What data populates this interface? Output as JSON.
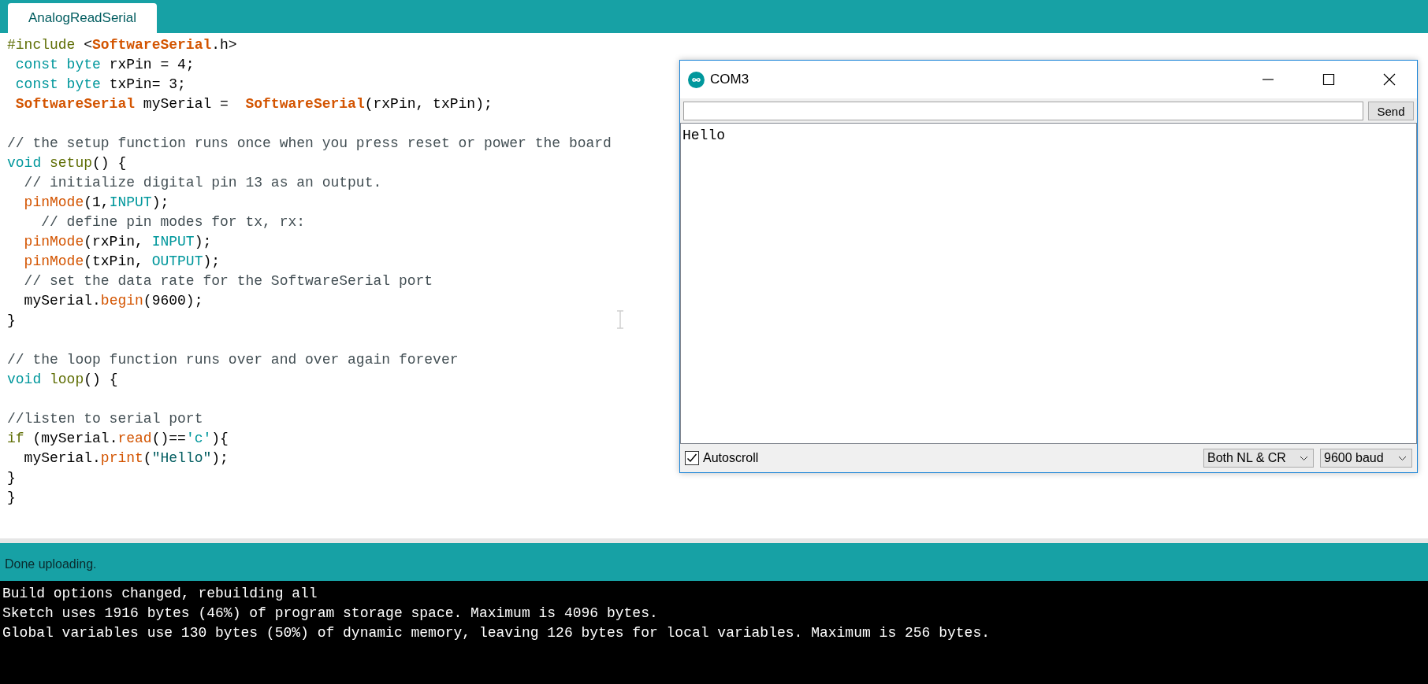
{
  "tabs": [
    {
      "label": "AnalogReadSerial",
      "selected": true
    }
  ],
  "editor": {
    "lines": [
      {
        "kind": "code",
        "tokens": [
          {
            "kind": "structure",
            "text": "#include"
          },
          {
            "kind": "plain",
            "text": " <"
          },
          {
            "kind": "class",
            "text": "SoftwareSerial"
          },
          {
            "kind": "plain",
            "text": ".h>"
          }
        ]
      },
      {
        "kind": "code",
        "tokens": [
          {
            "kind": "keyword",
            "text": " const"
          },
          {
            "kind": "keyword",
            "text": " byte"
          },
          {
            "kind": "plain",
            "text": " rxPin = 4;"
          }
        ]
      },
      {
        "kind": "code",
        "tokens": [
          {
            "kind": "keyword",
            "text": " const"
          },
          {
            "kind": "keyword",
            "text": " byte"
          },
          {
            "kind": "plain",
            "text": " txPin= 3;"
          }
        ]
      },
      {
        "kind": "code",
        "tokens": [
          {
            "kind": "class",
            "text": " SoftwareSerial"
          },
          {
            "kind": "plain",
            "text": " mySerial =  "
          },
          {
            "kind": "class",
            "text": "SoftwareSerial"
          },
          {
            "kind": "plain",
            "text": "(rxPin, txPin);"
          }
        ]
      },
      {
        "kind": "blank"
      },
      {
        "kind": "code",
        "tokens": [
          {
            "kind": "comment",
            "text": "// the setup function runs once when you press reset or power the board"
          }
        ]
      },
      {
        "kind": "code",
        "tokens": [
          {
            "kind": "keyword",
            "text": "void"
          },
          {
            "kind": "structure",
            "text": " setup"
          },
          {
            "kind": "plain",
            "text": "() {"
          }
        ]
      },
      {
        "kind": "code",
        "tokens": [
          {
            "kind": "comment",
            "text": "  // initialize digital pin 13 as an output."
          }
        ]
      },
      {
        "kind": "code",
        "tokens": [
          {
            "kind": "function",
            "text": "  pinMode"
          },
          {
            "kind": "plain",
            "text": "(1,"
          },
          {
            "kind": "constant",
            "text": "INPUT"
          },
          {
            "kind": "plain",
            "text": ");"
          }
        ]
      },
      {
        "kind": "code",
        "tokens": [
          {
            "kind": "comment",
            "text": "    // define pin modes for tx, rx:"
          }
        ]
      },
      {
        "kind": "code",
        "tokens": [
          {
            "kind": "function",
            "text": "  pinMode"
          },
          {
            "kind": "plain",
            "text": "(rxPin, "
          },
          {
            "kind": "constant",
            "text": "INPUT"
          },
          {
            "kind": "plain",
            "text": ");"
          }
        ]
      },
      {
        "kind": "code",
        "tokens": [
          {
            "kind": "function",
            "text": "  pinMode"
          },
          {
            "kind": "plain",
            "text": "(txPin, "
          },
          {
            "kind": "constant",
            "text": "OUTPUT"
          },
          {
            "kind": "plain",
            "text": ");"
          }
        ]
      },
      {
        "kind": "code",
        "tokens": [
          {
            "kind": "comment",
            "text": "  // set the data rate for the SoftwareSerial port"
          }
        ]
      },
      {
        "kind": "code",
        "tokens": [
          {
            "kind": "plain",
            "text": "  mySerial."
          },
          {
            "kind": "function",
            "text": "begin"
          },
          {
            "kind": "plain",
            "text": "(9600);"
          }
        ]
      },
      {
        "kind": "code",
        "tokens": [
          {
            "kind": "plain",
            "text": "}"
          }
        ]
      },
      {
        "kind": "blank"
      },
      {
        "kind": "code",
        "tokens": [
          {
            "kind": "comment",
            "text": "// the loop function runs over and over again forever"
          }
        ]
      },
      {
        "kind": "code",
        "tokens": [
          {
            "kind": "keyword",
            "text": "void"
          },
          {
            "kind": "structure",
            "text": " loop"
          },
          {
            "kind": "plain",
            "text": "() {"
          }
        ]
      },
      {
        "kind": "blank"
      },
      {
        "kind": "code",
        "tokens": [
          {
            "kind": "comment",
            "text": "//listen to serial port"
          }
        ]
      },
      {
        "kind": "code",
        "tokens": [
          {
            "kind": "structure",
            "text": "if"
          },
          {
            "kind": "plain",
            "text": " (mySerial."
          },
          {
            "kind": "function",
            "text": "read"
          },
          {
            "kind": "plain",
            "text": "()=="
          },
          {
            "kind": "constant",
            "text": "'c'"
          },
          {
            "kind": "plain",
            "text": "){"
          }
        ]
      },
      {
        "kind": "code",
        "tokens": [
          {
            "kind": "plain",
            "text": "  mySerial."
          },
          {
            "kind": "function",
            "text": "print"
          },
          {
            "kind": "plain",
            "text": "("
          },
          {
            "kind": "string",
            "text": "\"Hello\""
          },
          {
            "kind": "plain",
            "text": ");"
          }
        ]
      },
      {
        "kind": "code",
        "tokens": [
          {
            "kind": "plain",
            "text": "}"
          }
        ]
      },
      {
        "kind": "code",
        "tokens": [
          {
            "kind": "plain",
            "text": "}"
          }
        ]
      }
    ]
  },
  "serial_monitor": {
    "title": "COM3",
    "send_button": "Send",
    "output": [
      "Hello"
    ],
    "autoscroll": {
      "label": "Autoscroll",
      "checked": true
    },
    "line_ending": "Both NL & CR",
    "baud_rate": "9600 baud"
  },
  "status_bar": "Done uploading.",
  "console": [
    "Build options changed, rebuilding all",
    "Sketch uses 1916 bytes (46%) of program storage space. Maximum is 4096 bytes.",
    "Global variables use 130 bytes (50%) of dynamic memory, leaving 126 bytes for local variables. Maximum is 256 bytes."
  ]
}
